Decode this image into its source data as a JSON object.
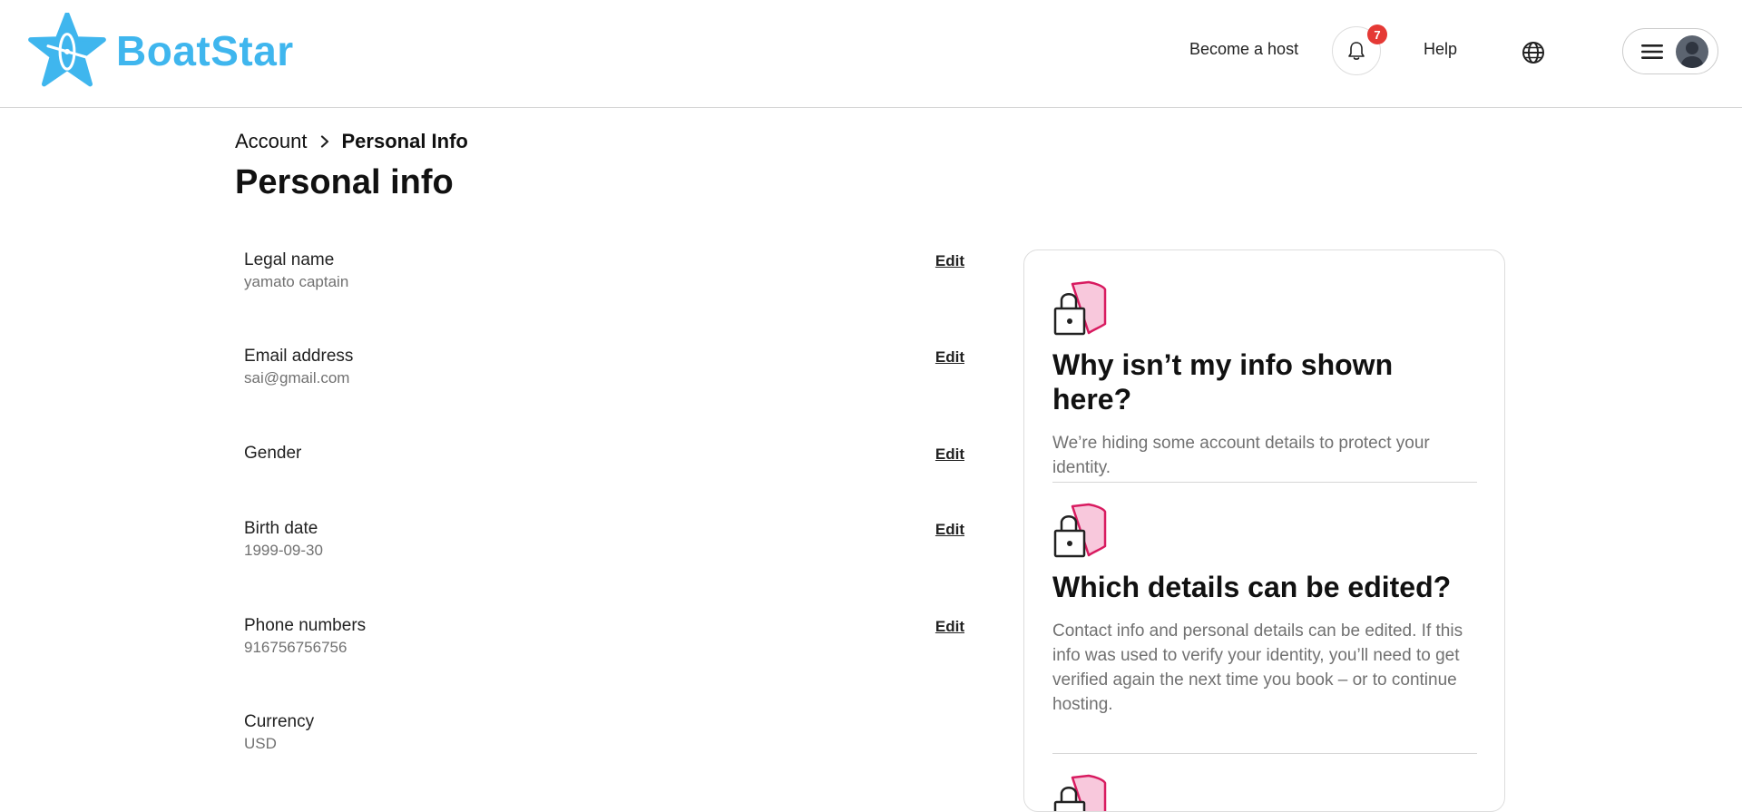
{
  "brand": {
    "name": "BoatStar",
    "color": "#3fb6ee"
  },
  "header": {
    "become_host": "Become a host",
    "notifications": {
      "icon": "bell-icon",
      "count": "7"
    },
    "help": "Help",
    "language_icon": "globe-icon",
    "menu_icon": "hamburger-icon",
    "avatar_icon": "user-avatar"
  },
  "breadcrumb": {
    "parent": "Account",
    "separator_icon": "chevron-right-icon",
    "current": "Personal Info"
  },
  "page_title": "Personal info",
  "info_rows": [
    {
      "label": "Legal name",
      "value": "yamato captain",
      "action": "Edit"
    },
    {
      "label": "Email address",
      "value": "sai@gmail.com",
      "action": "Edit"
    },
    {
      "label": "Gender",
      "value": "",
      "action": "Edit"
    },
    {
      "label": "Birth date",
      "value": "1999-09-30",
      "action": "Edit"
    },
    {
      "label": "Phone numbers",
      "value": "916756756756",
      "action": "Edit"
    },
    {
      "label": "Currency",
      "value": "USD",
      "action": ""
    }
  ],
  "side_card": {
    "sections": [
      {
        "icon": "lock-shield-icon",
        "heading": "Why isn’t my info shown here?",
        "text": "We’re hiding some account details to protect your identity."
      },
      {
        "icon": "lock-shield-icon",
        "heading": "Which details can be edited?",
        "text": "Contact info and personal details can be edited. If this info was used to verify your identity, you’ll need to get verified again the next time you book – or to continue hosting."
      },
      {
        "icon": "lock-shield-icon",
        "heading": "",
        "text": ""
      }
    ]
  },
  "colors": {
    "accent_pink": "#d81b60",
    "pink_fill": "#f8c8dc",
    "badge_red": "#e53935",
    "muted_text": "#717171"
  }
}
